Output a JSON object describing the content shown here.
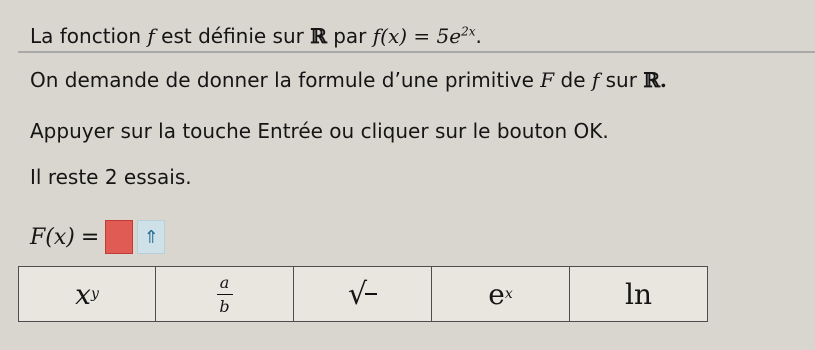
{
  "statement": {
    "intro": "La fonction",
    "f": "f",
    "mid": "est définie sur",
    "R": "ℝ",
    "par": "par",
    "fx": "f(x) = 5e",
    "exponent": "2x",
    "period": "."
  },
  "task": {
    "text": "On demande de donner la formule d’une primitive",
    "F": "F",
    "de": "de",
    "f": "f",
    "sur": "sur",
    "R": "ℝ."
  },
  "instruction": "Appuyer sur la touche Entrée ou cliquer sur le bouton OK.",
  "attempts": "Il reste 2 essais.",
  "answer": {
    "label": "F(x)",
    "equals": "=",
    "submit_icon": "double-up-arrow-icon"
  },
  "toolbar": {
    "power_base": "x",
    "power_exp": "y",
    "frac_num": "a",
    "frac_den": "b",
    "sqrt_symbol": "√",
    "exp_base": "e",
    "exp_power": "x",
    "ln": "ln"
  }
}
